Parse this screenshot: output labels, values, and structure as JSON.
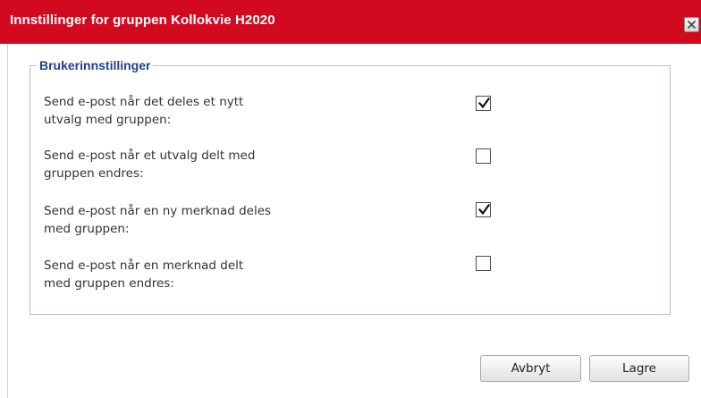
{
  "dialog": {
    "title": "Innstillinger for gruppen Kollokvie H2020",
    "close_icon": "close-x"
  },
  "section": {
    "legend": "Brukerinnstillinger",
    "settings": [
      {
        "label_line1": "Send e-post når det deles et nytt",
        "label_line2": "utvalg med gruppen:",
        "checked": true
      },
      {
        "label_line1": "Send e-post når et utvalg delt med",
        "label_line2": "gruppen endres:",
        "checked": false
      },
      {
        "label_line1": "Send e-post når en ny merknad deles",
        "label_line2": "med gruppen:",
        "checked": true
      },
      {
        "label_line1": "Send e-post når en merknad delt",
        "label_line2": "med gruppen endres:",
        "checked": false
      }
    ]
  },
  "buttons": {
    "cancel_label": "Avbryt",
    "save_label": "Lagre"
  },
  "colors": {
    "titlebar": "#d20a20",
    "legend": "#1f3f8f",
    "fieldset_border": "#b9bfd3"
  }
}
